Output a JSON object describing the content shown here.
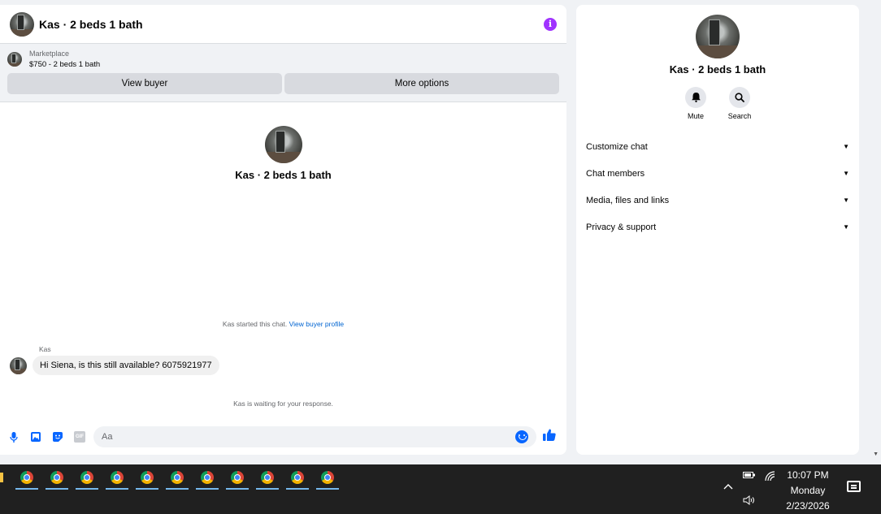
{
  "chat": {
    "title": "Kas · 2 beds 1 bath",
    "marketplace": {
      "category": "Marketplace",
      "listing": "$750 - 2 beds 1 bath",
      "view_buyer_label": "View buyer",
      "more_options_label": "More options"
    },
    "profile_name": "Kas · 2 beds 1 bath",
    "started_text": "Kas started this chat.",
    "view_profile_link": "View buyer profile",
    "sender_name": "Kas",
    "message": "Hi Siena, is this still available? 6075921977",
    "waiting_text": "Kas is waiting for your response.",
    "composer": {
      "placeholder": "Aa",
      "gif_label": "GIF"
    },
    "info_glyph": "i"
  },
  "info_panel": {
    "name": "Kas · 2 beds 1 bath",
    "actions": [
      {
        "label": "Mute",
        "icon": "bell-icon"
      },
      {
        "label": "Search",
        "icon": "search-icon"
      }
    ],
    "sections": [
      {
        "label": "Customize chat"
      },
      {
        "label": "Chat members"
      },
      {
        "label": "Media, files and links"
      },
      {
        "label": "Privacy & support"
      }
    ]
  },
  "taskbar": {
    "app_count": 11,
    "time": "10:07 PM",
    "day": "Monday",
    "date": "2/23/2026"
  },
  "colors": {
    "accent": "#0866ff",
    "info_purple": "#a033ff",
    "link": "#0064d1",
    "taskbar": "#202020"
  }
}
